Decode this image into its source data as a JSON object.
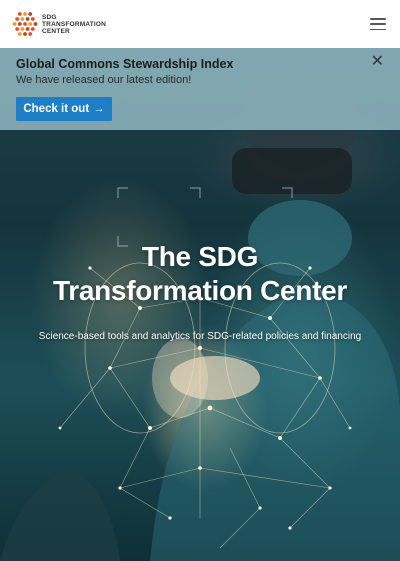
{
  "header": {
    "logo_lines": [
      "SDG",
      "TRANSFORMATION",
      "CENTER"
    ],
    "logo_colors": [
      "#e0542b",
      "#f29a2e",
      "#b7462a"
    ],
    "menu_icon": "hamburger-icon"
  },
  "banner": {
    "title": "Global Commons Stewardship Index",
    "text": "We have released our latest edition!",
    "button_label": "Check it out",
    "button_icon": "arrow-right-icon",
    "close_icon": "close-icon",
    "background": "#96bec8",
    "button_color": "#1f7ec4"
  },
  "hero": {
    "title_line1": "The SDG",
    "title_line2": "Transformation Center",
    "subtitle": "Science-based tools and analytics for SDG-related policies and financing"
  }
}
